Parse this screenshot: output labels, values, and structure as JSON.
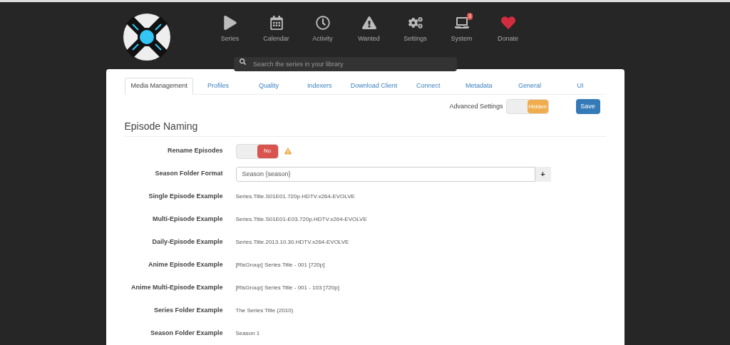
{
  "nav": [
    {
      "label": "Series"
    },
    {
      "label": "Calendar"
    },
    {
      "label": "Activity"
    },
    {
      "label": "Wanted"
    },
    {
      "label": "Settings"
    },
    {
      "label": "System",
      "badge": "3"
    },
    {
      "label": "Donate"
    }
  ],
  "search": {
    "placeholder": "Search the series in your library"
  },
  "tabs": [
    {
      "label": "Media Management",
      "selected": true
    },
    {
      "label": "Profiles",
      "selected": false
    },
    {
      "label": "Quality",
      "selected": false
    },
    {
      "label": "Indexers",
      "selected": false
    },
    {
      "label": "Download Client",
      "selected": false
    },
    {
      "label": "Connect",
      "selected": false
    },
    {
      "label": "Metadata",
      "selected": false
    },
    {
      "label": "General",
      "selected": false
    },
    {
      "label": "UI",
      "selected": false
    }
  ],
  "advanced": {
    "label": "Advanced Settings",
    "toggle": {
      "label": "Hidden",
      "on": false
    }
  },
  "save_button": "Save",
  "section_title": "Episode Naming",
  "rows": [
    {
      "kind": "toggle",
      "label": "Rename Episodes",
      "toggle": {
        "label": "No",
        "on": false
      },
      "warning": true
    },
    {
      "kind": "field",
      "label": "Season Folder Format",
      "value": "Season {season}",
      "button": "+"
    },
    {
      "kind": "text",
      "label": "Single Episode Example",
      "value": "Series.Title.S01E01.720p.HDTV.x264-EVOLVE"
    },
    {
      "kind": "text",
      "label": "Multi-Episode Example",
      "value": "Series.Title.S01E01-E03.720p.HDTV.x264-EVOLVE"
    },
    {
      "kind": "text",
      "label": "Daily-Episode Example",
      "value": "Series.Title.2013.10.30.HDTV.x264-EVOLVE"
    },
    {
      "kind": "text",
      "label": "Anime Episode Example",
      "value": "[RlsGroup] Series Title - 001 [720p]"
    },
    {
      "kind": "text",
      "label": "Anime Multi-Episode Example",
      "value": "[RlsGroup] Series Title - 001 - 103 [720p]"
    },
    {
      "kind": "text",
      "label": "Series Folder Example",
      "value": "The Series Title (2010)"
    },
    {
      "kind": "text",
      "label": "Season Folder Example",
      "value": "Season 1"
    }
  ]
}
